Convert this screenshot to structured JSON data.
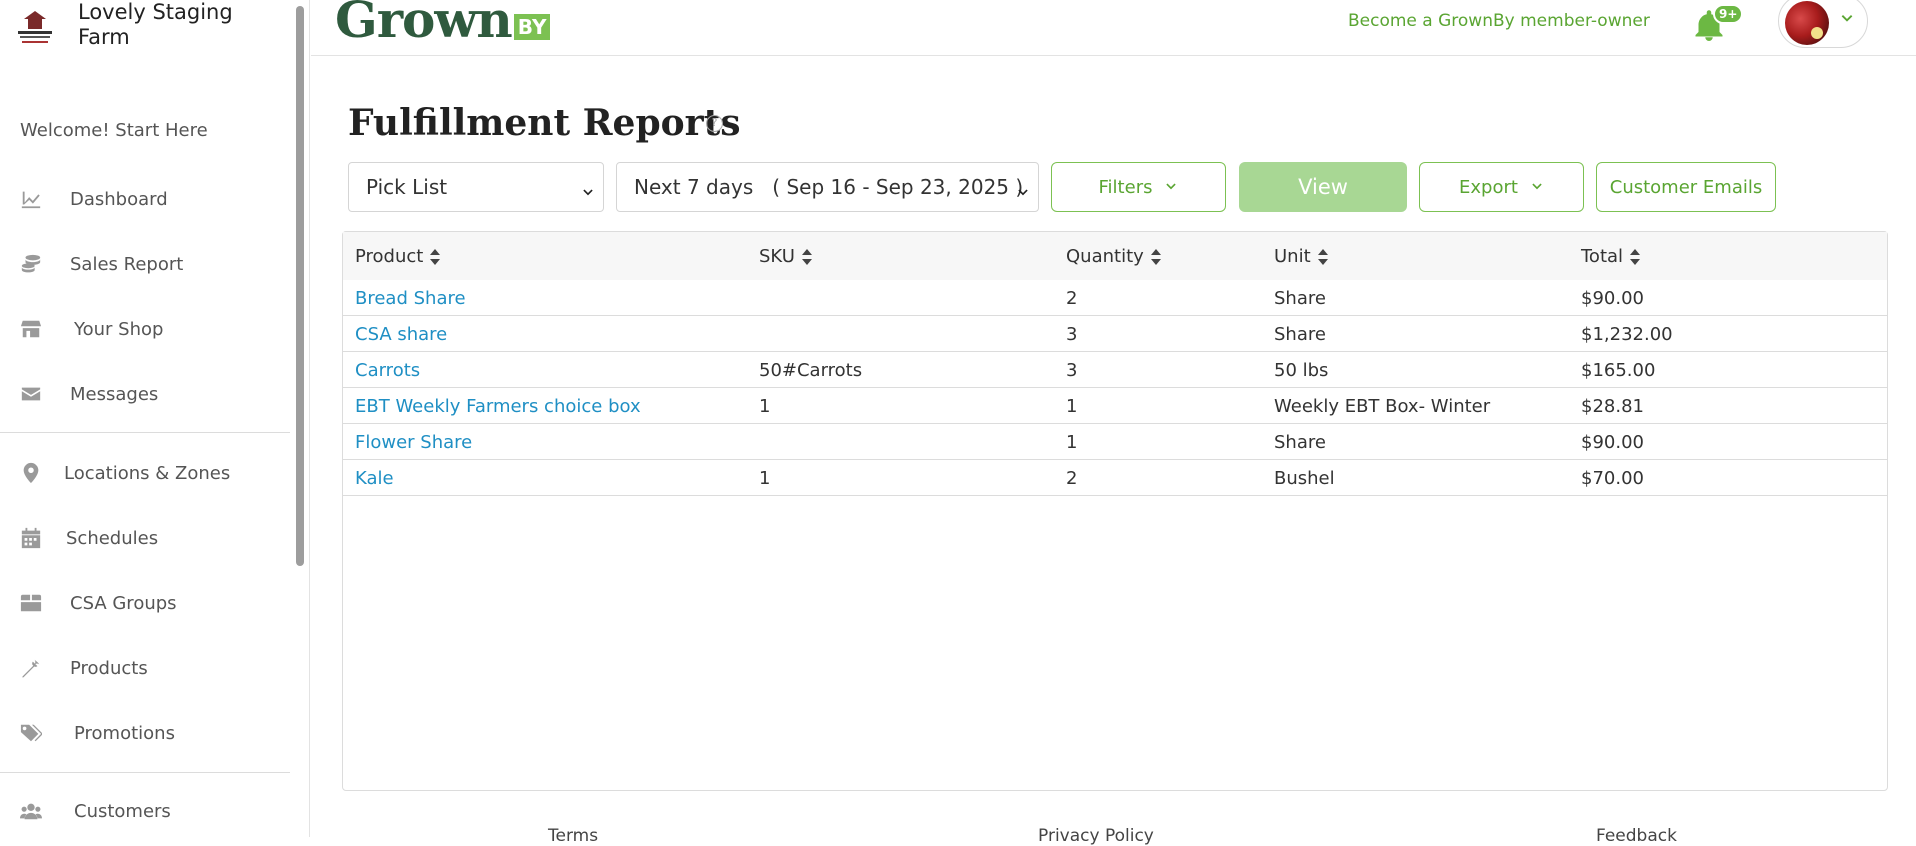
{
  "sidebar": {
    "farm_name_line1": "Lovely Staging",
    "farm_name_line2": "Farm",
    "welcome": "Welcome! Start Here",
    "items": [
      {
        "label": "Dashboard"
      },
      {
        "label": "Sales Report"
      },
      {
        "label": "Your Shop"
      },
      {
        "label": "Messages"
      },
      {
        "label": "Locations & Zones"
      },
      {
        "label": "Schedules"
      },
      {
        "label": "CSA Groups"
      },
      {
        "label": "Products"
      },
      {
        "label": "Promotions"
      },
      {
        "label": "Customers"
      }
    ]
  },
  "header": {
    "brand": "Grown",
    "brand_by": "BY",
    "member_link": "Become a GrownBy member-owner",
    "notification_badge": "9+"
  },
  "main": {
    "title": "Fulfillment Reports",
    "help": "?",
    "report_type": "Pick List",
    "date_range": "Next 7 days   ( Sep 16 - Sep 23, 2025 )",
    "filters_label": "Filters",
    "view_label": "View",
    "export_label": "Export",
    "customer_emails_label": "Customer Emails"
  },
  "table": {
    "headers": {
      "product": "Product",
      "sku": "SKU",
      "quantity": "Quantity",
      "unit": "Unit",
      "total": "Total"
    },
    "rows": [
      {
        "product": "Bread Share",
        "sku": "",
        "quantity": "2",
        "unit": "Share",
        "total": "$90.00"
      },
      {
        "product": "CSA share",
        "sku": "",
        "quantity": "3",
        "unit": "Share",
        "total": "$1,232.00"
      },
      {
        "product": "Carrots",
        "sku": "50#Carrots",
        "quantity": "3",
        "unit": "50 lbs",
        "total": "$165.00"
      },
      {
        "product": "EBT Weekly Farmers choice box",
        "sku": "1",
        "quantity": "1",
        "unit": "Weekly EBT Box- Winter",
        "total": "$28.81"
      },
      {
        "product": "Flower Share",
        "sku": "",
        "quantity": "1",
        "unit": "Share",
        "total": "$90.00"
      },
      {
        "product": "Kale",
        "sku": "1",
        "quantity": "2",
        "unit": "Bushel",
        "total": "$70.00"
      }
    ]
  },
  "footer": {
    "terms": "Terms",
    "privacy": "Privacy Policy",
    "feedback": "Feedback"
  },
  "colors": {
    "accent_green": "#7cc152",
    "brand_dark_green": "#2f5a3e",
    "link_blue": "#1f8fc4"
  }
}
